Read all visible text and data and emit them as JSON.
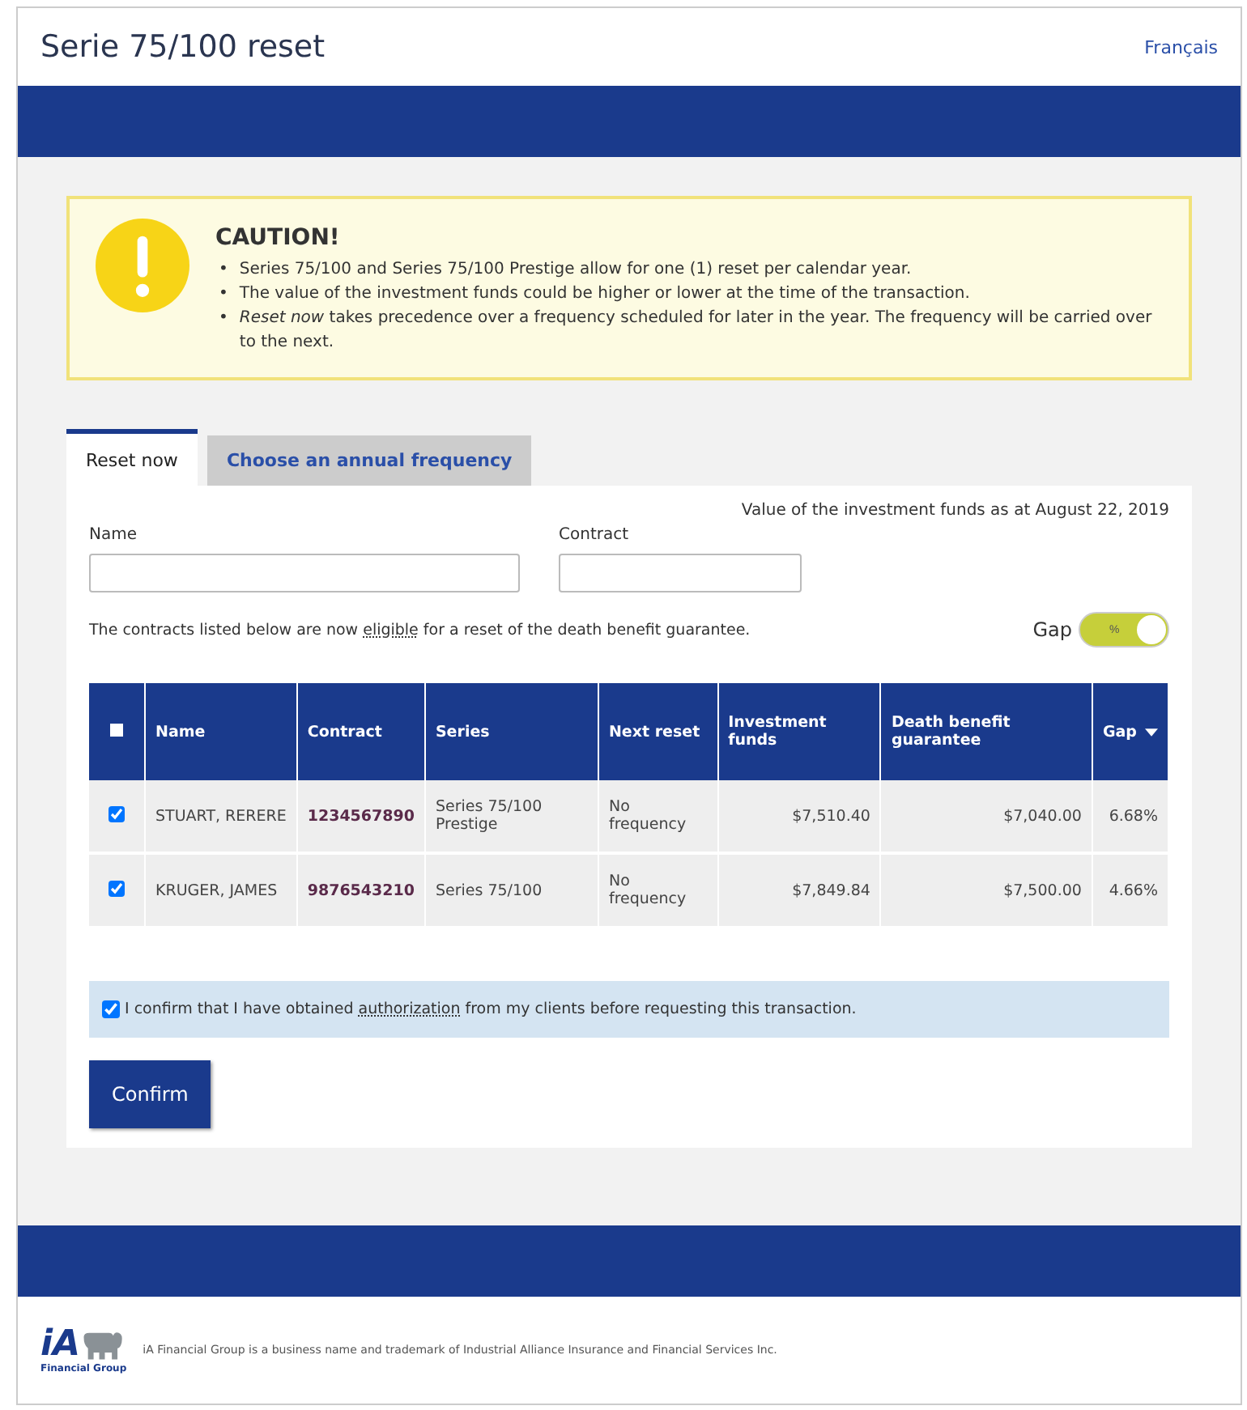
{
  "header": {
    "title": "Serie 75/100 reset",
    "language_link": "Français"
  },
  "caution": {
    "title": "CAUTION!",
    "items": [
      {
        "marker": "•",
        "text": "Series 75/100 and Series 75/100 Prestige allow for one (1) reset per calendar year."
      },
      {
        "marker": "•",
        "text": "The value of the investment funds could be higher or lower at the time of the transaction."
      },
      {
        "marker": "•",
        "text": "*Reset now* takes precedence over a frequency scheduled for later in the year. The frequency will be carried over to the next."
      }
    ]
  },
  "tabs": [
    {
      "label": "Reset now",
      "selected": true
    },
    {
      "label": "Choose an annual frequency",
      "selected": false
    }
  ],
  "valuation_note": "Value of the investment funds as at August 22, 2019",
  "fields": [
    {
      "label": "Name"
    },
    {
      "label": "Contract"
    }
  ],
  "eligibility_note": {
    "before": "The contracts listed below are now ",
    "term": "eligible",
    "after": " for a reset of the death benefit guarantee."
  },
  "gap_toggle": {
    "label": "Gap",
    "unit": "%",
    "on": true
  },
  "table": {
    "select_all_checked": false,
    "columns": [
      {
        "label": "Name",
        "sorted": false
      },
      {
        "label": "Contract",
        "sorted": false
      },
      {
        "label": "Series",
        "sorted": false
      },
      {
        "label": "Next reset",
        "sorted": false
      },
      {
        "label": "Investment funds",
        "sorted": false
      },
      {
        "label": "Death benefit guarantee",
        "sorted": false
      },
      {
        "label": "Gap",
        "sorted": true
      }
    ],
    "rows": [
      {
        "checked": true,
        "cells": [
          "STUART, RERERE",
          "1234567890",
          "Series 75/100 Prestige",
          "No frequency",
          "$7,510.40",
          "$7,040.00",
          "6.68%"
        ]
      },
      {
        "checked": true,
        "cells": [
          "KRUGER, JAMES",
          "9876543210",
          "Series 75/100",
          "No frequency",
          "$7,849.84",
          "$7,500.00",
          "4.66%"
        ]
      }
    ]
  },
  "confirmation": {
    "checked": true,
    "before": "I confirm that I have obtained ",
    "term": "authorization",
    "after": " from my clients before requesting this transaction."
  },
  "confirm_button": "Confirm",
  "footer": {
    "logo_mark": "iA",
    "logo_caption": "Financial Group",
    "legal": "iA Financial Group is a business name and trademark of Industrial Alliance Insurance and Financial Services Inc."
  }
}
